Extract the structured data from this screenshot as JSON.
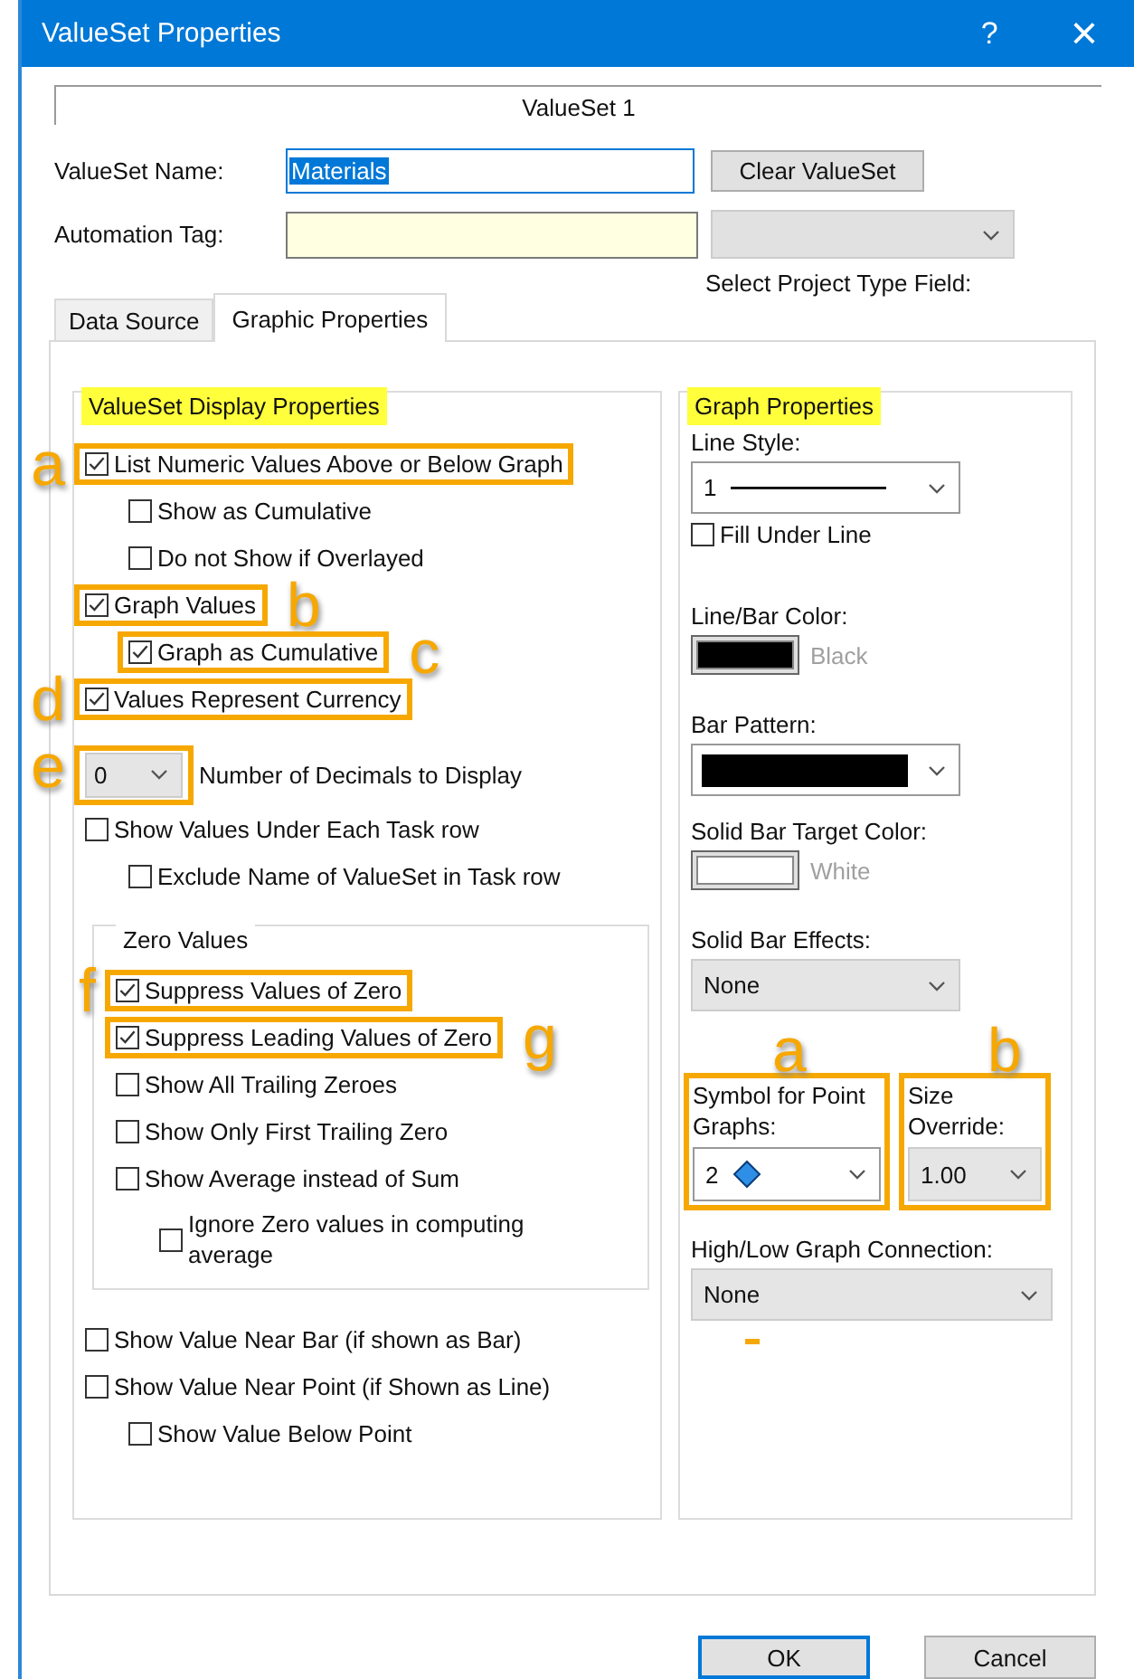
{
  "window": {
    "title": "ValueSet Properties",
    "help": "?",
    "close": "×"
  },
  "header": "ValueSet 1",
  "name_field": {
    "label": "ValueSet Name:",
    "value": "Materials",
    "value_selected": true,
    "button": "Clear ValueSet"
  },
  "automation_field": {
    "label": "Automation Tag:",
    "dropdown_label": "Select Project Type Field:"
  },
  "tabs": [
    {
      "label": "Data Source",
      "selected": false
    },
    {
      "label": "Graphic Properties",
      "selected": true
    }
  ],
  "display_group": {
    "title": "ValueSet Display Properties",
    "items": [
      {
        "kind": "checkbox",
        "label": "List Numeric Values Above or Below Graph",
        "checked": true,
        "highlighted": true,
        "left_callout": "a",
        "children": [
          {
            "kind": "checkbox",
            "label": "Show as Cumulative",
            "checked": false,
            "highlighted": false
          },
          {
            "kind": "checkbox",
            "label": "Do not Show if Overlayed",
            "checked": false,
            "highlighted": false
          }
        ]
      },
      {
        "kind": "checkbox",
        "label": "Graph Values",
        "checked": true,
        "highlighted": true,
        "right_callout": "b",
        "children": [
          {
            "kind": "checkbox",
            "label": "Graph as Cumulative",
            "checked": true,
            "highlighted": true,
            "right_callout": "c"
          }
        ]
      },
      {
        "kind": "checkbox",
        "label": "Values Represent Currency",
        "checked": true,
        "highlighted": true,
        "left_callout": "d"
      },
      {
        "kind": "dropdown",
        "dropdown": {
          "value": "0",
          "editable": false
        },
        "label": "Number of Decimals to Display",
        "highlighted": true,
        "left_callout": "e"
      },
      {
        "kind": "checkbox",
        "label": "Show Values Under Each Task row",
        "checked": false,
        "highlighted": false,
        "children": [
          {
            "kind": "checkbox",
            "label": "Exclude Name of ValueSet in Task row",
            "checked": false,
            "highlighted": false
          }
        ]
      },
      {
        "kind": "group",
        "title": "Zero Values",
        "children": [
          {
            "kind": "checkbox",
            "label": "Suppress Values of Zero",
            "checked": true,
            "highlighted": true,
            "left_callout": "f"
          },
          {
            "kind": "checkbox",
            "label": "Suppress Leading Values of Zero",
            "checked": true,
            "highlighted": true,
            "right_callout": "g"
          },
          {
            "kind": "checkbox",
            "label": "Show All Trailing Zeroes",
            "checked": false,
            "highlighted": false
          },
          {
            "kind": "checkbox",
            "label": "Show Only First Trailing Zero",
            "checked": false,
            "highlighted": false
          },
          {
            "kind": "checkbox",
            "label": "Show Average instead of Sum",
            "checked": false,
            "highlighted": false,
            "children": [
              {
                "kind": "checkbox",
                "label": "Ignore Zero values in computing average",
                "checked": false,
                "highlighted": false
              }
            ]
          }
        ]
      },
      {
        "kind": "checkbox",
        "label": "Show Value Near Bar (if shown as Bar)",
        "checked": false,
        "highlighted": false
      },
      {
        "kind": "checkbox",
        "label": "Show Value Near Point (if Shown as Line)",
        "checked": false,
        "highlighted": false,
        "children": [
          {
            "kind": "checkbox",
            "label": "Show Value Below Point",
            "checked": false,
            "highlighted": false
          }
        ]
      }
    ]
  },
  "graph_group": {
    "title": "Graph Properties",
    "fields": [
      {
        "kind": "line-style",
        "label": "Line Style:",
        "value": "1",
        "editable": true
      },
      {
        "kind": "checkbox",
        "label": "Fill Under Line",
        "checked": false
      },
      {
        "kind": "swatch",
        "label": "Line/Bar Color:",
        "color": "#000000",
        "value": "Black"
      },
      {
        "kind": "pattern",
        "label": "Bar Pattern:",
        "editable": true
      },
      {
        "kind": "swatch",
        "label": "Solid Bar Target Color:",
        "color": "#ffffff",
        "value": "White"
      },
      {
        "kind": "dropdown",
        "label": "Solid Bar Effects:",
        "value": "None",
        "editable": false
      },
      {
        "kind": "pair",
        "children": [
          {
            "kind": "symbol",
            "label": "Symbol for Point Graphs:",
            "value": "2",
            "editable": true,
            "highlighted": true,
            "callout": "a"
          },
          {
            "kind": "dropdown",
            "label": "Size Override:",
            "value": "1.00",
            "editable": false,
            "highlighted": true,
            "callout": "b"
          }
        ]
      },
      {
        "kind": "dropdown",
        "label": "High/Low Graph Connection:",
        "value": "None",
        "editable": false
      }
    ]
  },
  "buttons": [
    {
      "label": "OK",
      "default": true
    },
    {
      "label": "Cancel",
      "default": false
    }
  ]
}
